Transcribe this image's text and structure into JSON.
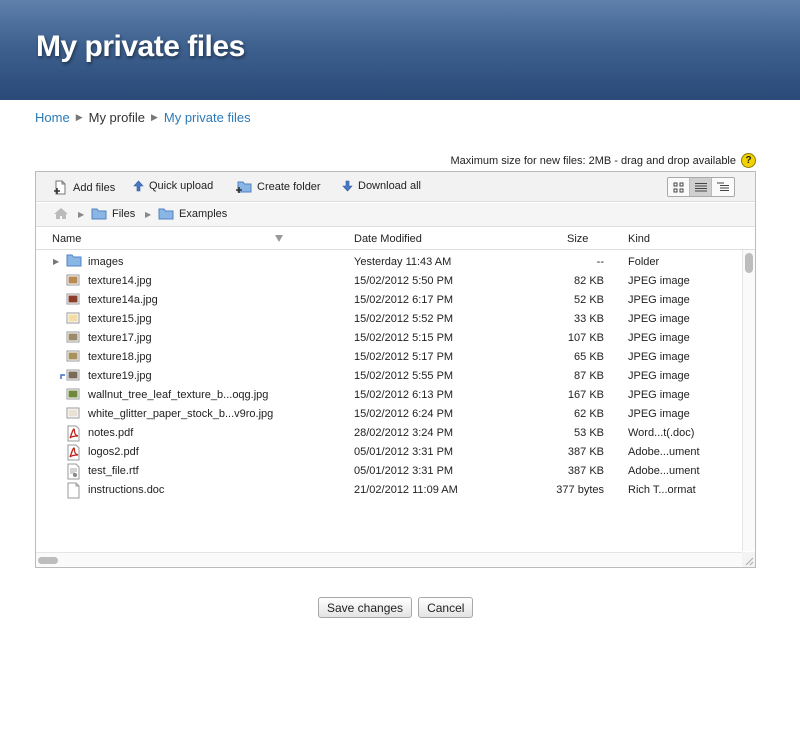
{
  "header": {
    "title": "My private files"
  },
  "breadcrumb": {
    "home": "Home",
    "profile": "My profile",
    "current": "My private files"
  },
  "info": {
    "max_size": "Maximum size for new files: 2MB - drag and drop available",
    "help_glyph": "?"
  },
  "toolbar": {
    "add_files": "Add files",
    "quick_upload": "Quick upload",
    "create_folder": "Create folder",
    "download_all": "Download all",
    "active_view": "list"
  },
  "path": {
    "files": "Files",
    "examples": "Examples"
  },
  "columns": {
    "name": "Name",
    "date": "Date Modified",
    "size": "Size",
    "kind": "Kind"
  },
  "files": [
    {
      "name": "images",
      "date": "Yesterday 11:43 AM",
      "size": "--",
      "kind": "Folder",
      "icon": "folder-icon"
    },
    {
      "name": "texture14.jpg",
      "date": "15/02/2012 5:50 PM",
      "size": "82 KB",
      "kind": "JPEG image",
      "icon": "image-thumbnail-icon"
    },
    {
      "name": "texture14a.jpg",
      "date": "15/02/2012 6:17 PM",
      "size": "52 KB",
      "kind": "JPEG image",
      "icon": "image-thumbnail-icon"
    },
    {
      "name": "texture15.jpg",
      "date": "15/02/2012 5:52 PM",
      "size": "33 KB",
      "kind": "JPEG image",
      "icon": "image-thumbnail-icon"
    },
    {
      "name": "texture17.jpg",
      "date": "15/02/2012 5:15 PM",
      "size": "107 KB",
      "kind": "JPEG image",
      "icon": "image-thumbnail-icon"
    },
    {
      "name": "texture18.jpg",
      "date": "15/02/2012 5:17 PM",
      "size": "65 KB",
      "kind": "JPEG image",
      "icon": "image-thumbnail-icon"
    },
    {
      "name": "texture19.jpg",
      "date": "15/02/2012 5:55 PM",
      "size": "87 KB",
      "kind": "JPEG image",
      "icon": "image-thumbnail-icon"
    },
    {
      "name": "wallnut_tree_leaf_texture_b...oqg.jpg",
      "date": "15/02/2012 6:13 PM",
      "size": "167 KB",
      "kind": "JPEG image",
      "icon": "image-thumbnail-icon"
    },
    {
      "name": "white_glitter_paper_stock_b...v9ro.jpg",
      "date": "15/02/2012 6:24 PM",
      "size": "62 KB",
      "kind": "JPEG image",
      "icon": "image-thumbnail-icon"
    },
    {
      "name": "notes.pdf",
      "date": "28/02/2012 3:24 PM",
      "size": "53 KB",
      "kind": "Word...t(.doc)",
      "icon": "pdf-icon"
    },
    {
      "name": "logos2.pdf",
      "date": "05/01/2012 3:31 PM",
      "size": "387 KB",
      "kind": "Adobe...ument",
      "icon": "pdf-icon"
    },
    {
      "name": "test_file.rtf",
      "date": "05/01/2012 3:31 PM",
      "size": "387 KB",
      "kind": "Adobe...ument",
      "icon": "rtf-document-icon"
    },
    {
      "name": "instructions.doc",
      "date": "21/02/2012 11:09 AM",
      "size": "377 bytes",
      "kind": "Rich T...ormat",
      "icon": "document-icon"
    }
  ],
  "actions": {
    "save": "Save changes",
    "cancel": "Cancel"
  },
  "colors": {
    "header_top": "#5f80ab",
    "header_bottom": "#2a4a78",
    "link": "#2b7ab8",
    "help": "#f2d100"
  }
}
